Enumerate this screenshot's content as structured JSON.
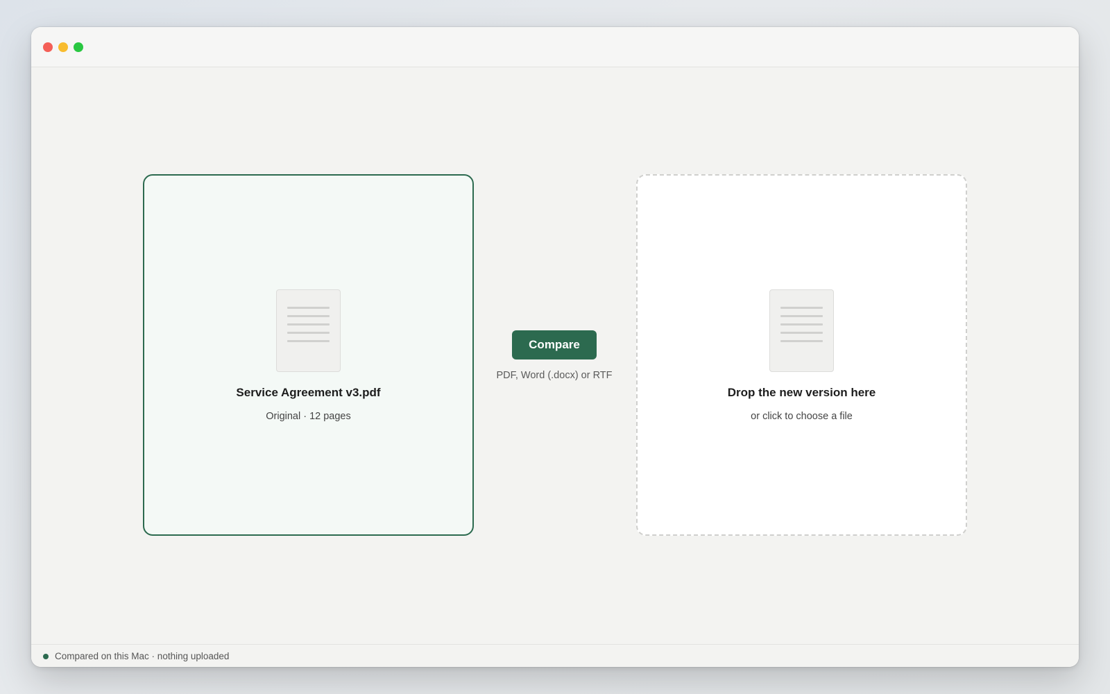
{
  "window": {
    "controls": [
      "close",
      "minimize",
      "maximize"
    ]
  },
  "original_file": {
    "icon": "document-icon",
    "name": "Service Agreement v3.pdf",
    "meta": "Original · 12 pages"
  },
  "drop_zone": {
    "icon": "document-icon",
    "title": "Drop the new version here",
    "subtitle": "or click to choose a file"
  },
  "actions": {
    "compare_label": "Compare",
    "formats_hint": "PDF, Word (.docx) or RTF"
  },
  "status": {
    "text": "Compared on this Mac · nothing uploaded",
    "indicator_color": "#2c6a4f"
  },
  "colors": {
    "accent": "#2c6a4f",
    "close": "#f45f57",
    "minimize": "#f8bc2e",
    "maximize": "#29c741"
  }
}
